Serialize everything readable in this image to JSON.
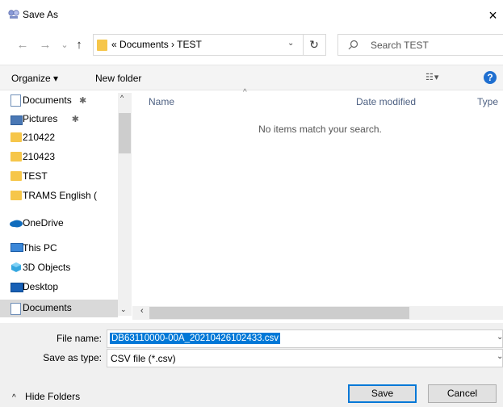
{
  "window": {
    "title": "Save As",
    "close_label": "×"
  },
  "nav": {
    "back": "←",
    "forward": "→",
    "history": "⌄",
    "up": "↑"
  },
  "address": {
    "path": "« Documents › TEST",
    "dropdown": "⌄",
    "refresh": "↻"
  },
  "search": {
    "placeholder": "Search TEST",
    "icon": "search-icon"
  },
  "toolbar": {
    "organize": "Organize ▾",
    "new_folder": "New folder",
    "view": "☷ ▾",
    "help": "?"
  },
  "sidebar": {
    "items": [
      {
        "label": "Documents",
        "pin": "📌",
        "icon": "documents-icon"
      },
      {
        "label": "Pictures",
        "pin": "📌",
        "icon": "pictures-icon"
      },
      {
        "label": "210422",
        "icon": "folder-icon"
      },
      {
        "label": "210423",
        "icon": "folder-icon"
      },
      {
        "label": "TEST",
        "icon": "folder-icon"
      },
      {
        "label": "TRAMS English (",
        "icon": "folder-icon"
      },
      {
        "label": "OneDrive",
        "icon": "onedrive-icon"
      },
      {
        "label": "This PC",
        "icon": "this-pc-icon"
      },
      {
        "label": "3D Objects",
        "icon": "3d-objects-icon"
      },
      {
        "label": "Desktop",
        "icon": "desktop-icon"
      },
      {
        "label": "Documents",
        "icon": "documents-icon",
        "selected": true
      }
    ]
  },
  "columns": {
    "name": "Name",
    "date_modified": "Date modified",
    "type": "Type",
    "sort_arrow": "^"
  },
  "content": {
    "empty_message": "No items match your search."
  },
  "form": {
    "file_name_label": "File name:",
    "file_name_value": "DB63110000-00A_20210426102433.csv",
    "save_as_type_label": "Save as type:",
    "save_as_type_value": "CSV file (*.csv)"
  },
  "footer": {
    "hide_folders": "Hide Folders",
    "save": "Save",
    "cancel": "Cancel"
  }
}
